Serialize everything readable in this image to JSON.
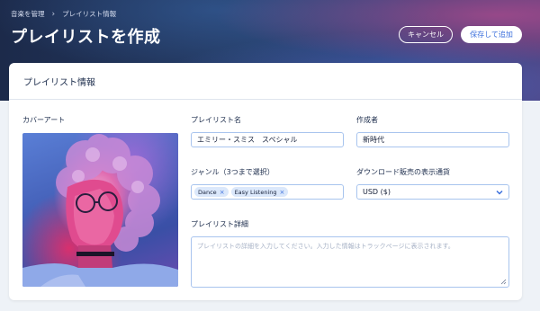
{
  "breadcrumb": {
    "parent": "音楽を管理",
    "current": "プレイリスト情報"
  },
  "page_title": "プレイリストを作成",
  "actions": {
    "cancel": "キャンセル",
    "save": "保存して追加"
  },
  "card": {
    "title": "プレイリスト情報"
  },
  "form": {
    "cover_art_label": "カバーアート",
    "playlist_name": {
      "label": "プレイリスト名",
      "value": "エミリー・スミス　スペシャル"
    },
    "creator": {
      "label": "作成者",
      "value": "新時代"
    },
    "genre": {
      "label": "ジャンル（3つまで選択）",
      "tags": [
        "Dance",
        "Easy Listening"
      ]
    },
    "currency": {
      "label": "ダウンロード販売の表示通貨",
      "value": "USD ($)"
    },
    "details": {
      "label": "プレイリスト詳細",
      "placeholder": "プレイリストの詳細を入力してください。入力した情報はトラックページに表示されます。"
    }
  },
  "colors": {
    "accent": "#3b6fdc",
    "input_border": "#a8c4ee",
    "tag_bg": "#dbe8fb"
  },
  "icons": [
    "chevron-right-icon",
    "chevron-down-icon",
    "close-icon",
    "resize-handle-icon"
  ]
}
